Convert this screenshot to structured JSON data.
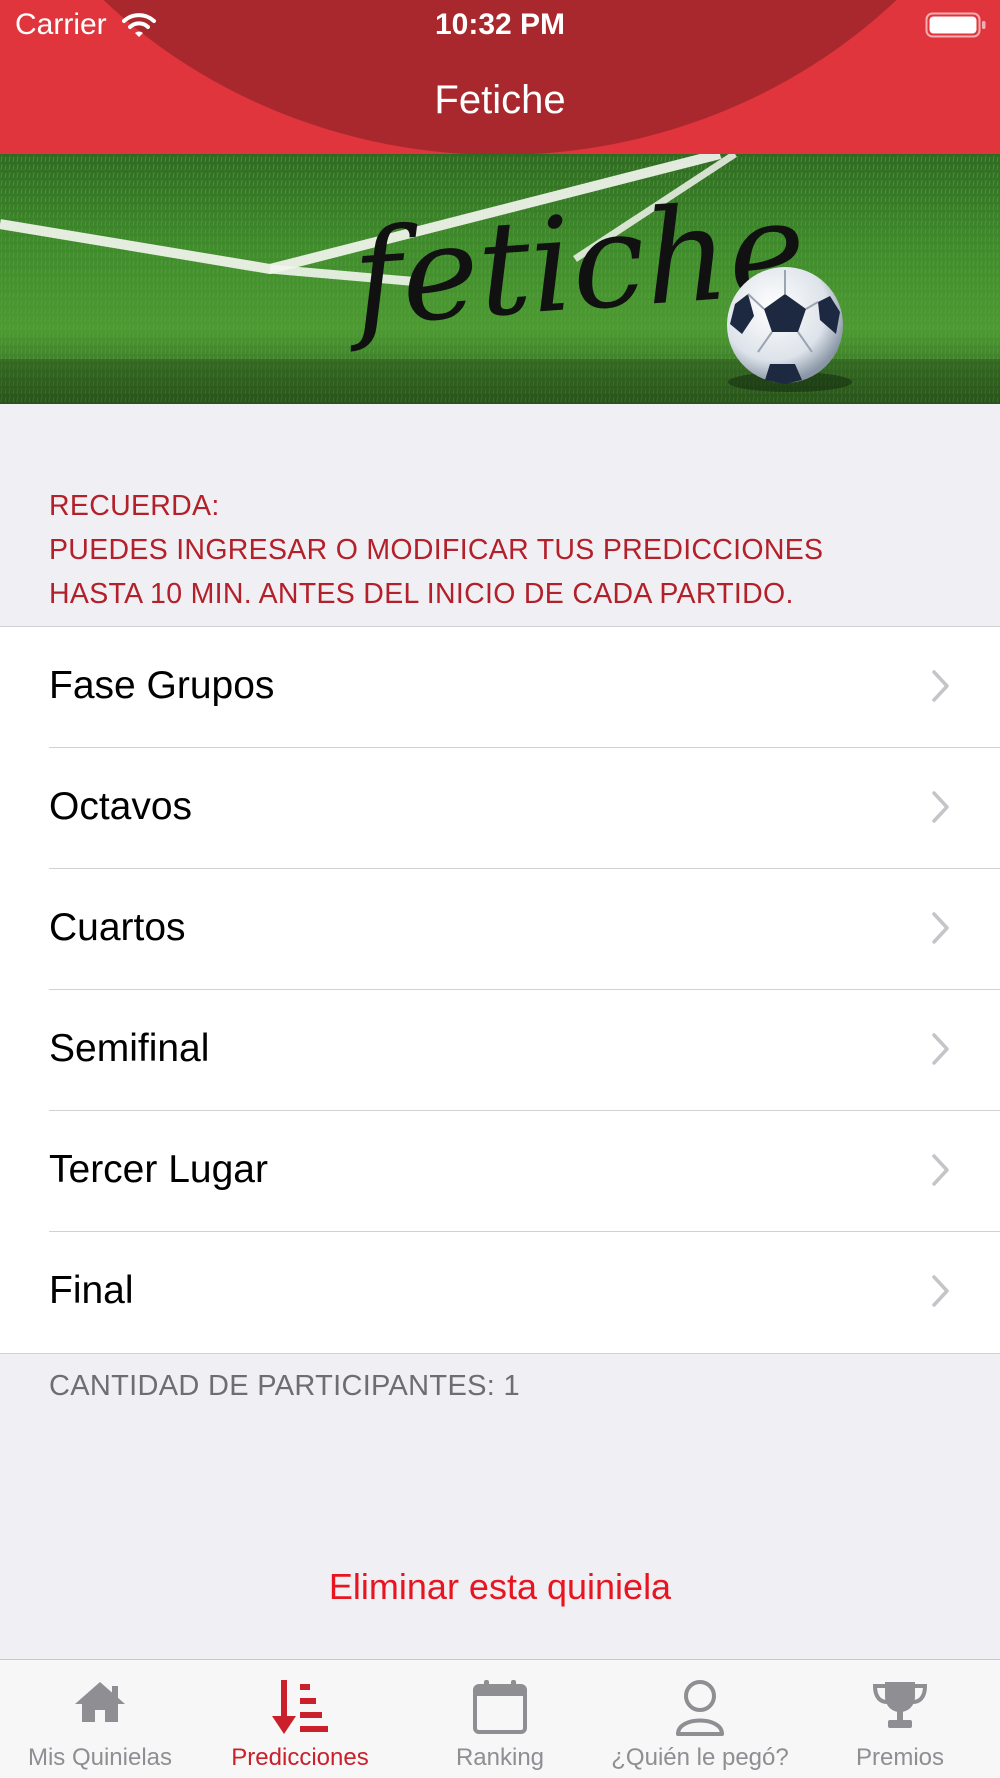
{
  "status_bar": {
    "carrier": "Carrier",
    "time": "10:32 PM"
  },
  "nav": {
    "title": "Fetiche"
  },
  "banner": {
    "logo_text": "fetiche"
  },
  "reminder": {
    "line1": "RECUERDA:",
    "line2": "PUEDES INGRESAR O MODIFICAR TUS PREDICCIONES",
    "line3": "HASTA 10 MIN. ANTES DEL INICIO DE CADA PARTIDO."
  },
  "stages": [
    {
      "label": "Fase Grupos"
    },
    {
      "label": "Octavos"
    },
    {
      "label": "Cuartos"
    },
    {
      "label": "Semifinal"
    },
    {
      "label": "Tercer Lugar"
    },
    {
      "label": "Final"
    }
  ],
  "participants": "CANTIDAD DE PARTICIPANTES: 1",
  "delete_label": "Eliminar esta quiniela",
  "tabs": [
    {
      "label": "Mis Quinielas",
      "icon": "home-icon",
      "active": false
    },
    {
      "label": "Predicciones",
      "icon": "sort-predictions-icon",
      "active": true
    },
    {
      "label": "Ranking",
      "icon": "calendar-icon",
      "active": false
    },
    {
      "label": "¿Quién le pegó?",
      "icon": "person-icon",
      "active": false
    },
    {
      "label": "Premios",
      "icon": "trophy-icon",
      "active": false
    }
  ],
  "colors": {
    "header_red": "#e0353c",
    "header_dark_red": "#a9282e",
    "reminder_red": "#b3202a",
    "delete_red": "#e8141f",
    "tab_active": "#c9202b",
    "tab_inactive": "#8e8e93",
    "background": "#efeff4"
  }
}
